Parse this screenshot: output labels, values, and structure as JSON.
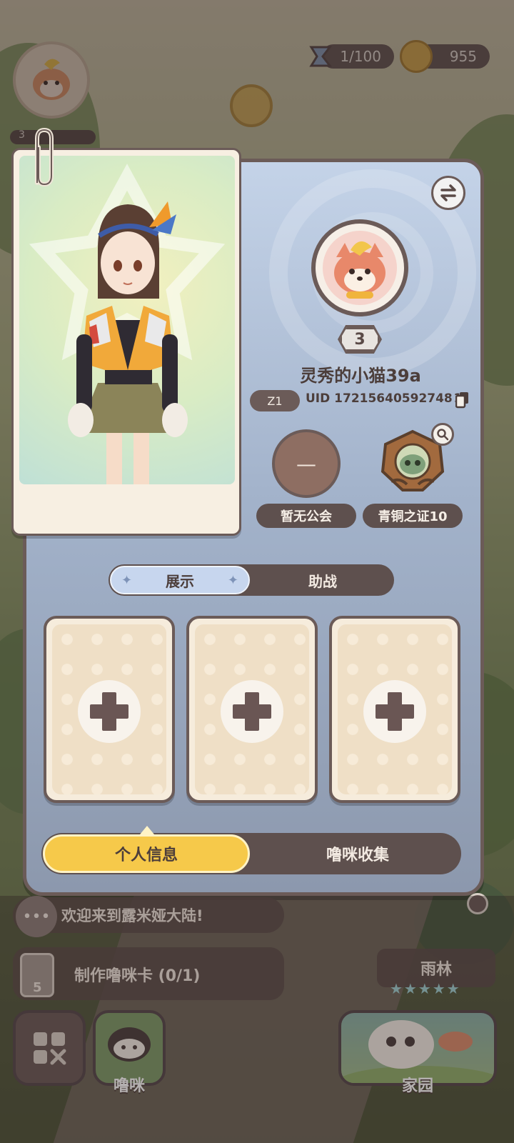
{
  "hud": {
    "energy": "1/100",
    "coins": "955",
    "player_level_small": "3"
  },
  "profile": {
    "level": "3",
    "nickname": "灵秀的小猫39a",
    "server": "Z1",
    "uid": "UID 17215640592748 1",
    "guild_symbol": "—",
    "guild_label": "暂无公会",
    "badge_label": "青铜之证10"
  },
  "tabs": {
    "display": "展示",
    "assist": "助战"
  },
  "slots": [
    {
      "state": "empty"
    },
    {
      "state": "empty"
    },
    {
      "state": "empty"
    }
  ],
  "bottom_tabs": {
    "personal_info": "个人信息",
    "collection": "噜咪收集"
  },
  "chat": {
    "message": "欢迎来到露米娅大陆!"
  },
  "task": {
    "count": "5",
    "label": "制作噜咪卡 (0/1)"
  },
  "biome": {
    "name": "雨林",
    "stars": "★★★★★"
  },
  "nav": {
    "pet": "噜咪",
    "home": "家园"
  },
  "colors": {
    "panel_border": "#6b5b58",
    "accent_yellow": "#f6c94a",
    "tab_blue": "#c7d6ee"
  }
}
